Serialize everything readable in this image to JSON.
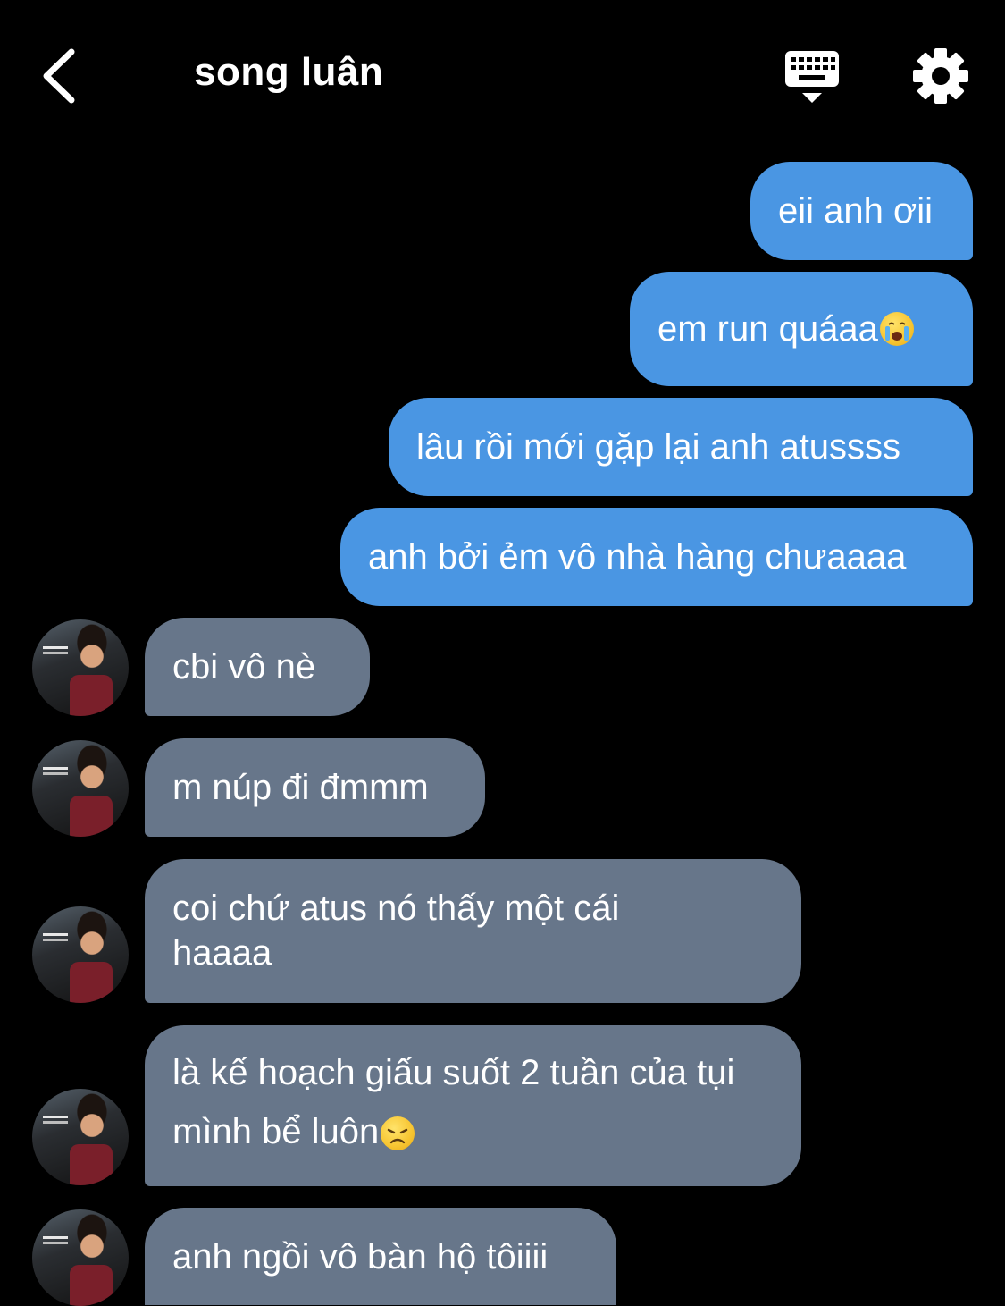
{
  "header": {
    "title": "song luân",
    "back_icon": "chevron-left-icon",
    "keyboard_icon": "keyboard-icon",
    "settings_icon": "gear-icon"
  },
  "colors": {
    "background": "#000000",
    "outgoing_bubble": "#4a96e3",
    "incoming_bubble": "#67768a",
    "text": "#ffffff"
  },
  "messages": [
    {
      "direction": "outgoing",
      "text": "eii anh ơii"
    },
    {
      "direction": "outgoing",
      "text": "em run quáaa",
      "emoji": "crying-face-emoji"
    },
    {
      "direction": "outgoing",
      "text": "lâu rồi mới gặp lại anh atussss"
    },
    {
      "direction": "outgoing",
      "text": "anh bởi ẻm vô nhà hàng chưaaaa"
    },
    {
      "direction": "incoming",
      "text": "cbi vô nè"
    },
    {
      "direction": "incoming",
      "text": "m núp đi đmmm"
    },
    {
      "direction": "incoming",
      "text": "coi chứ atus nó thấy một cái haaaa"
    },
    {
      "direction": "incoming",
      "text": "là kế hoạch giấu suốt 2 tuần của tụi mình bể luôn",
      "emoji": "disappointed-face-emoji"
    },
    {
      "direction": "incoming",
      "text": "anh ngồi vô bàn hộ tôiiii"
    }
  ]
}
